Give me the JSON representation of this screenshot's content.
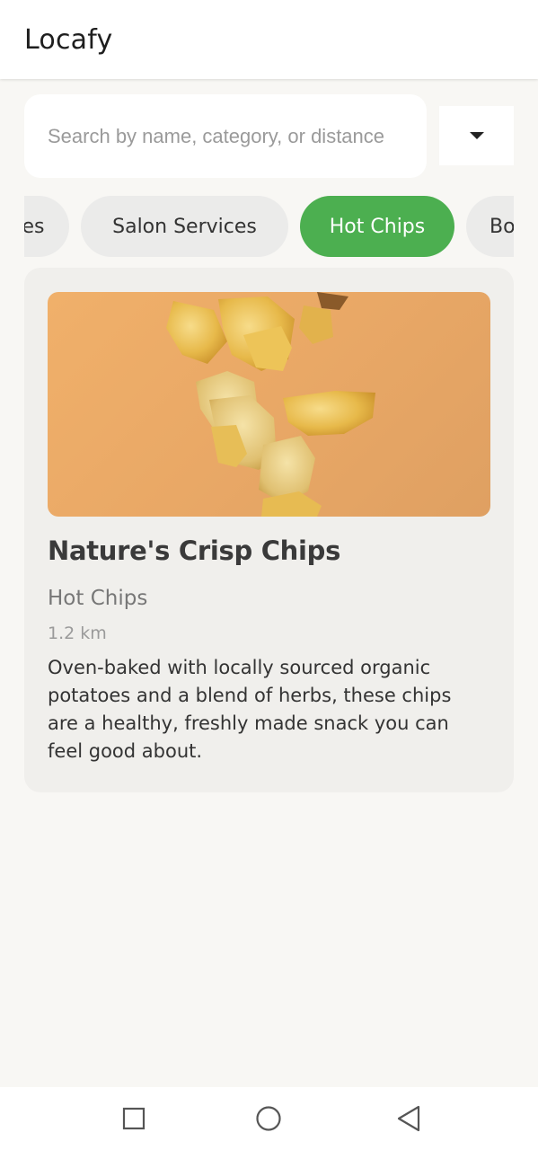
{
  "app": {
    "title": "Locafy"
  },
  "search": {
    "placeholder": "Search by name, category, or distance",
    "value": "",
    "dropdown_icon": "caret-down-icon"
  },
  "categories": [
    {
      "label": "es",
      "active": false
    },
    {
      "label": "Salon Services",
      "active": false
    },
    {
      "label": "Hot Chips",
      "active": true
    },
    {
      "label": "Bo",
      "active": false
    }
  ],
  "listing": {
    "name": "Nature's Crisp Chips",
    "category": "Hot Chips",
    "distance": "1.2 km",
    "description": "Oven-baked with locally sourced organic potatoes and a blend of herbs, these chips are a healthy, freshly made snack you can feel good about.",
    "image_alt": "potato chips falling on orange background"
  },
  "nav": {
    "recents_icon": "square-icon",
    "home_icon": "circle-icon",
    "back_icon": "triangle-back-icon"
  },
  "colors": {
    "accent": "#4caf50",
    "background": "#f8f7f4",
    "card": "#f0efec",
    "chip": "#ebebea"
  }
}
